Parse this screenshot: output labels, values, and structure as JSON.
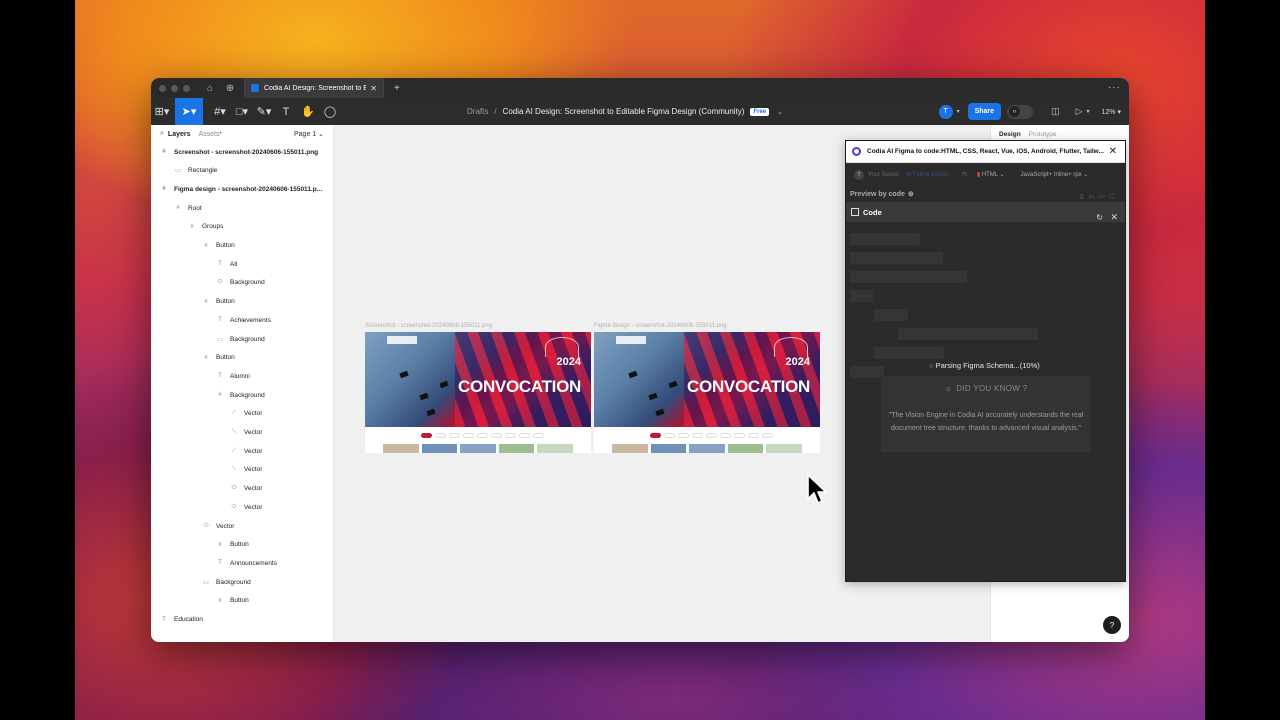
{
  "tabbar": {
    "tab_title": "Codia AI Design: Screenshot to Edi",
    "new_tab": "+",
    "more": "···"
  },
  "toolbar": {
    "breadcrumb_drafts": "Drafts",
    "breadcrumb_sep": "/",
    "file_name": "Codia AI Design: Screenshot to Editable Figma Design (Community)",
    "free_badge": "Free",
    "avatar_initial": "T",
    "share_label": "Share",
    "zoom": "12%"
  },
  "layers_panel": {
    "tab_layers": "Layers",
    "tab_assets": "Assets",
    "page": "Page 1",
    "items": [
      {
        "icon": "#",
        "label": "Screenshot - screenshot-20240606-155011.png",
        "bold": true
      },
      {
        "icon": "▭",
        "label": "Rectangle",
        "bold": false
      },
      {
        "icon": "#",
        "label": "Figma design - screenshot-20240606-155011.p...",
        "bold": true
      },
      {
        "icon": "#",
        "label": "Root",
        "bold": false
      },
      {
        "icon": "#",
        "label": "Groups",
        "bold": false
      },
      {
        "icon": "#",
        "label": "Button",
        "bold": false
      },
      {
        "icon": "T",
        "label": "All",
        "bold": false
      },
      {
        "icon": "⬭",
        "label": "Background",
        "bold": false
      },
      {
        "icon": "#",
        "label": "Button",
        "bold": false
      },
      {
        "icon": "T",
        "label": "Achievements",
        "bold": false
      },
      {
        "icon": "▭",
        "label": "Background",
        "bold": false
      },
      {
        "icon": "#",
        "label": "Button",
        "bold": false
      },
      {
        "icon": "T",
        "label": "Alumni",
        "bold": false
      },
      {
        "icon": "#",
        "label": "Background",
        "bold": false
      },
      {
        "icon": "⟋",
        "label": "Vector",
        "bold": false
      },
      {
        "icon": "⟍",
        "label": "Vector",
        "bold": false
      },
      {
        "icon": "⟋",
        "label": "Vector",
        "bold": false
      },
      {
        "icon": "⟍",
        "label": "Vector",
        "bold": false
      },
      {
        "icon": "⬭",
        "label": "Vector",
        "bold": false
      },
      {
        "icon": "⬭",
        "label": "Vector",
        "bold": false
      },
      {
        "icon": "⬭",
        "label": "Vector",
        "bold": false
      },
      {
        "icon": "#",
        "label": "Button",
        "bold": false
      },
      {
        "icon": "T",
        "label": "Announcements",
        "bold": false
      },
      {
        "icon": "▭",
        "label": "Background",
        "bold": false
      },
      {
        "icon": "#",
        "label": "Button",
        "bold": false
      },
      {
        "icon": "T",
        "label": "Education",
        "bold": false
      }
    ]
  },
  "canvas": {
    "frame1_label": "Screenshot - screenshot-20240606-155011.png",
    "frame2_label": "Figma design - screenshot-20240606-155011.png",
    "banner_title": "CONVOCATION",
    "banner_year": "2024"
  },
  "plugin": {
    "name": "Codia AI Figma to code:HTML, CSS, React, Vue, iOS, Android, Flutter, Tailw...",
    "avatar_initial": "T",
    "your_select": "Your Select:",
    "framework": "HTML",
    "language": "JavaScript+ Inline+ rpx",
    "preview_label": "Preview by code",
    "code_label": "Code",
    "parsing_status": "Parsing Figma Schema...(10%)",
    "did_you_know_title": "DID YOU KNOW ?",
    "did_you_know_text": "\"The Vision Engine in Codia AI accurately understands the real document tree structure, thanks to advanced visual analysis.\""
  },
  "right_panel": {
    "tab_design": "Design",
    "tab_prototype": "Prototype"
  },
  "help_label": "?",
  "colors": {
    "accent": "#1a74e8",
    "toolbar_bg": "#2c2c2c",
    "plugin_bg": "#2b2b2b",
    "canvas_bg": "#f0f0f0"
  }
}
